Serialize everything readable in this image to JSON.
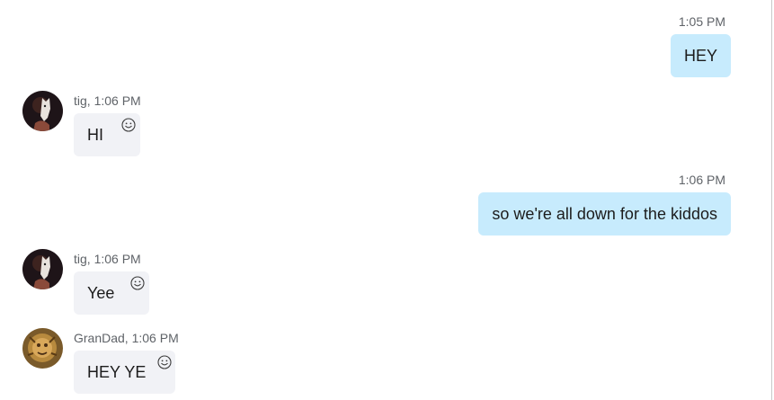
{
  "messages": [
    {
      "direction": "outgoing",
      "time": "1:05 PM",
      "text": "HEY"
    },
    {
      "direction": "incoming",
      "sender": "tig,",
      "time": "1:06 PM",
      "text": "HI",
      "avatar": "tig-avatar"
    },
    {
      "direction": "outgoing",
      "time": "1:06 PM",
      "text": "so we're all down for the kiddos"
    },
    {
      "direction": "incoming",
      "sender": "tig,",
      "time": "1:06 PM",
      "text": "Yee",
      "avatar": "tig-avatar"
    },
    {
      "direction": "incoming",
      "sender": "GranDad,",
      "time": "1:06 PM",
      "text": "HEY YE",
      "avatar": "grandad-avatar"
    }
  ],
  "colors": {
    "outgoing_bubble": "#c7ebfd",
    "incoming_bubble": "#f1f2f6",
    "meta_text": "#5f6368",
    "message_text": "#1c1c1c"
  },
  "icons": {
    "reaction": "smiley-icon"
  }
}
